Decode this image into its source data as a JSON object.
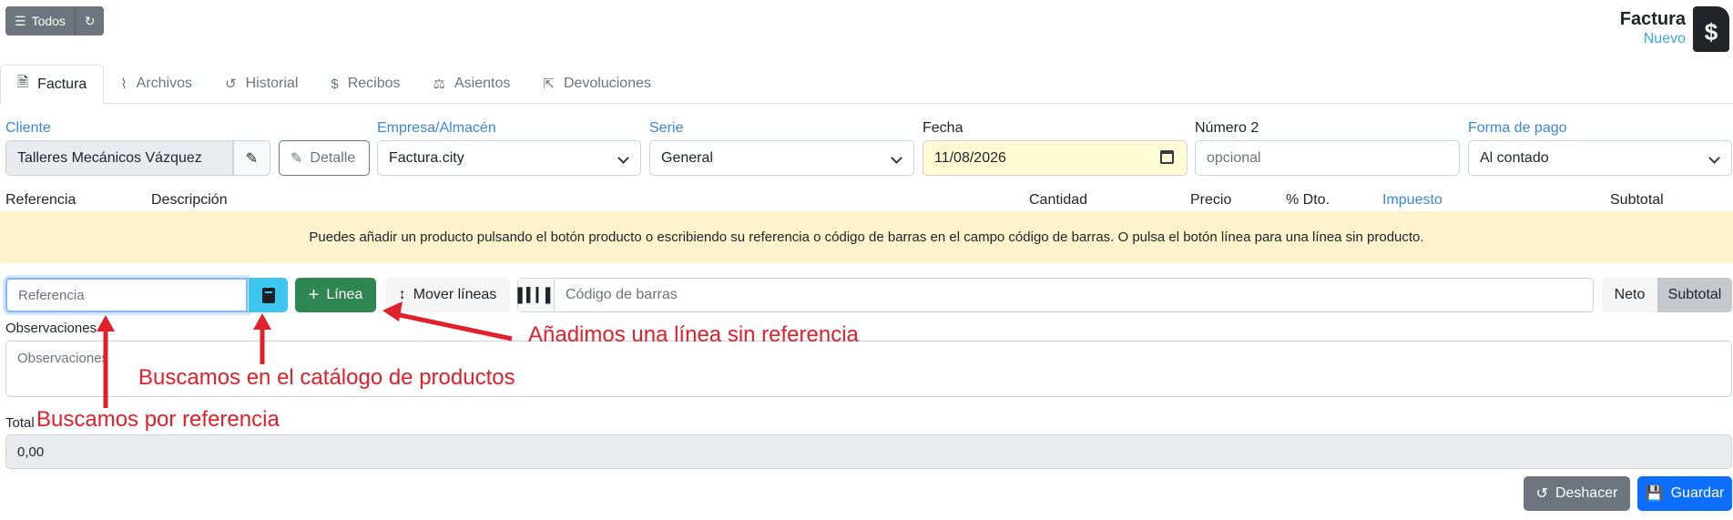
{
  "toolbar": {
    "todos_label": "Todos",
    "list_icon": "list-icon",
    "refresh_icon": "refresh-icon"
  },
  "header": {
    "title": "Factura",
    "status": "Nuevo",
    "doc_icon": "invoice-dollar-icon",
    "doc_symbol": "$"
  },
  "tabs": [
    {
      "label": "Factura",
      "icon": "file-icon",
      "glyph": "🗎",
      "active": true
    },
    {
      "label": "Archivos",
      "icon": "paperclip-icon",
      "glyph": "⌇"
    },
    {
      "label": "Historial",
      "icon": "history-icon",
      "glyph": "↺"
    },
    {
      "label": "Recibos",
      "icon": "dollar-icon",
      "glyph": "$"
    },
    {
      "label": "Asientos",
      "icon": "balance-scale-icon",
      "glyph": "⚖"
    },
    {
      "label": "Devoluciones",
      "icon": "share-icon",
      "glyph": "⇱"
    }
  ],
  "form": {
    "cliente": {
      "label": "Cliente",
      "value": "Talleres Mecánicos Vázquez",
      "detalle_label": "Detalle",
      "edit_icon": "pencil-icon"
    },
    "empresa": {
      "label": "Empresa/Almacén",
      "value": "Factura.city"
    },
    "serie": {
      "label": "Serie",
      "value": "General"
    },
    "fecha": {
      "label": "Fecha",
      "value": "11/08/2026"
    },
    "numero2": {
      "label": "Número 2",
      "placeholder": "opcional"
    },
    "forma_pago": {
      "label": "Forma de pago",
      "value": "Al contado"
    }
  },
  "lines_header": {
    "referencia": "Referencia",
    "descripcion": "Descripción",
    "cantidad": "Cantidad",
    "precio": "Precio",
    "dto": "% Dto.",
    "impuesto": "Impuesto",
    "subtotal": "Subtotal"
  },
  "notice": "Puedes añadir un producto pulsando el botón producto o escribiendo su referencia o código de barras en el campo código de barras. O pulsa el botón línea para una línea sin producto.",
  "line_tools": {
    "referencia_placeholder": "Referencia",
    "catalog_icon": "book-icon",
    "linea_label": "Línea",
    "mover_label": "Mover líneas",
    "barcode_icon": "barcode-icon",
    "barcode_placeholder": "Código de barras",
    "neto_label": "Neto",
    "subtotal_label": "Subtotal"
  },
  "observaciones": {
    "label": "Observaciones",
    "placeholder": "Observaciones"
  },
  "total": {
    "label": "Total",
    "value": "0,00"
  },
  "footer": {
    "deshacer_label": "Deshacer",
    "guardar_label": "Guardar"
  },
  "annotations": {
    "linea": "Añadimos una línea sin referencia",
    "catalogo": "Buscamos en el catálogo de productos",
    "referencia": "Buscamos por referencia"
  },
  "colors": {
    "annotation": "#e0202a",
    "primary": "#0d6efd",
    "success": "#2e8650",
    "info": "#3dc7f0",
    "notice_bg": "#fff3cd"
  }
}
